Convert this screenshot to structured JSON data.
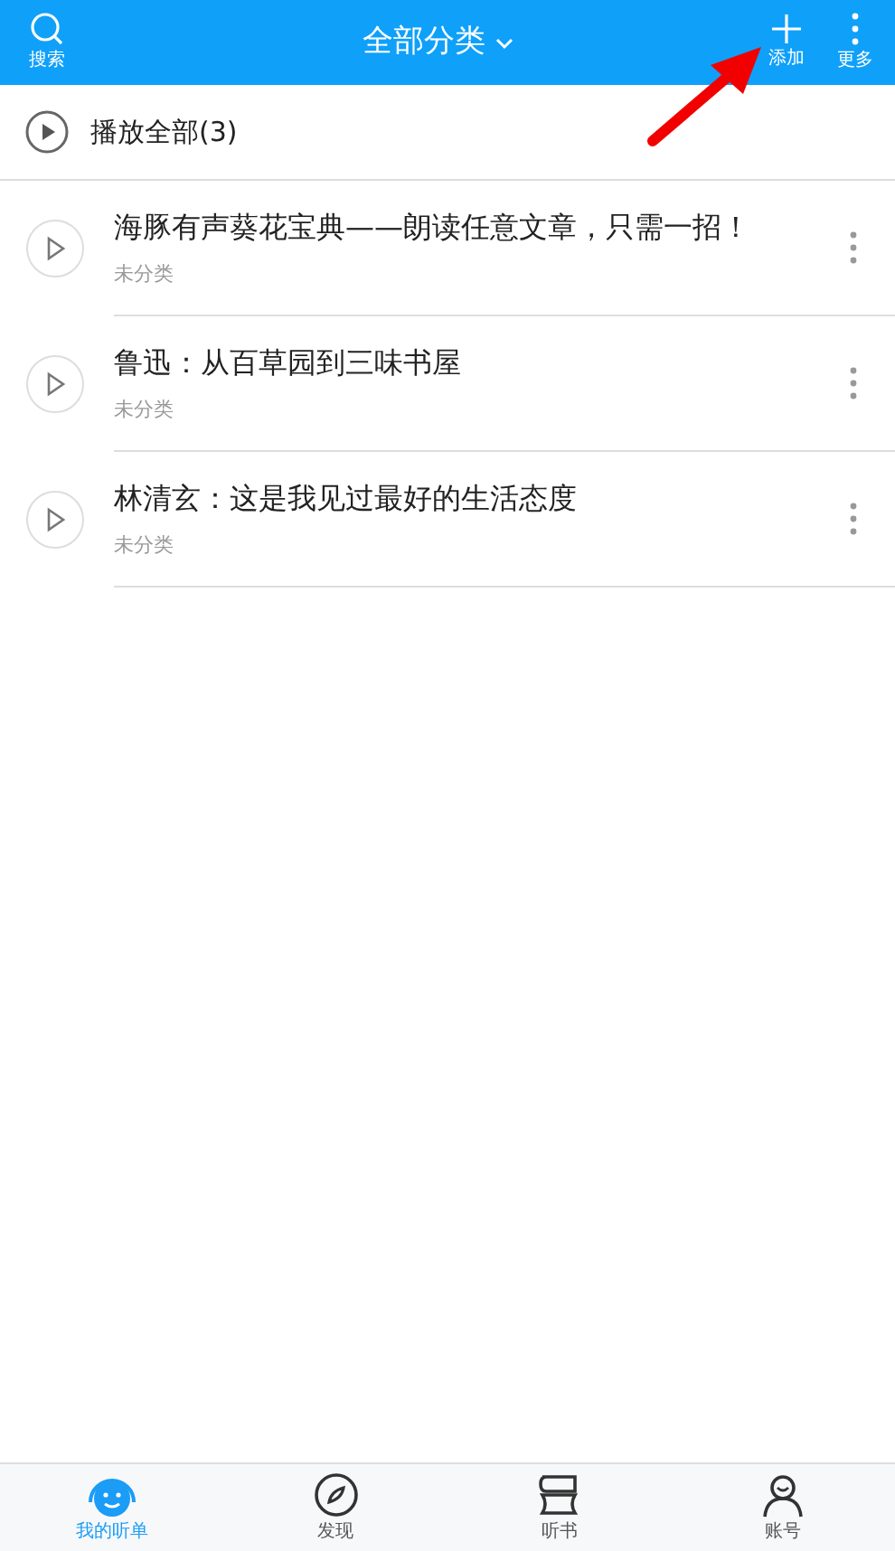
{
  "header": {
    "search_label": "搜索",
    "title": "全部分类",
    "add_label": "添加",
    "more_label": "更多"
  },
  "play_all": {
    "label": "播放全部(3)"
  },
  "items": [
    {
      "title": "海豚有声葵花宝典——朗读任意文章，只需一招！",
      "category": "未分类"
    },
    {
      "title": "鲁迅：从百草园到三味书屋",
      "category": "未分类"
    },
    {
      "title": "林清玄：这是我见过最好的生活态度",
      "category": "未分类"
    }
  ],
  "tabs": [
    {
      "kind": "playlist",
      "label": "我的听单",
      "selected": true
    },
    {
      "kind": "discover",
      "label": "发现",
      "selected": false
    },
    {
      "kind": "books",
      "label": "听书",
      "selected": false
    },
    {
      "kind": "account",
      "label": "账号",
      "selected": false
    }
  ]
}
